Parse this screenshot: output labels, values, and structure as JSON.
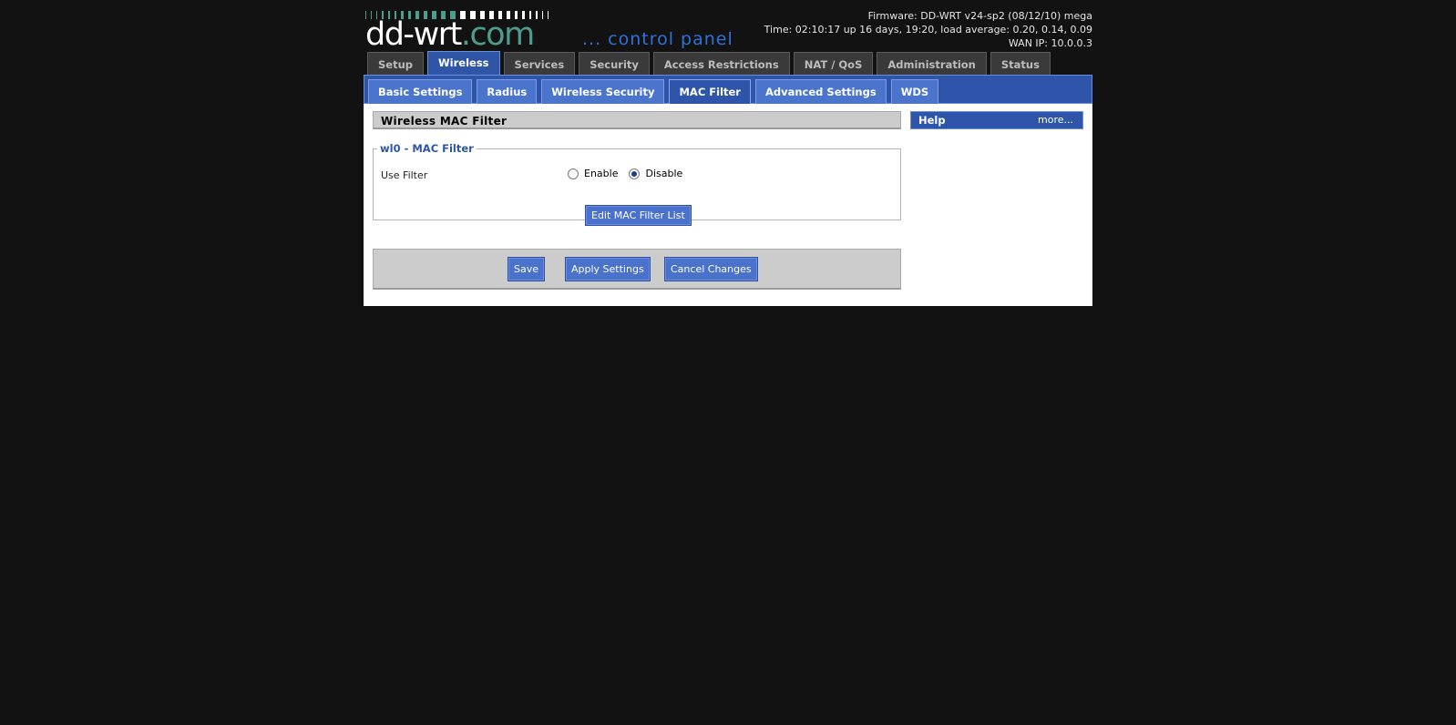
{
  "logo": {
    "main": "dd-wrt",
    "dotcom": ".com",
    "tagline": "... control panel",
    "bar_colors": [
      "#4d9c8e",
      "#ffffff"
    ]
  },
  "info": {
    "firmware": "Firmware: DD-WRT v24-sp2 (08/12/10) mega",
    "time": "Time: 02:10:17 up 16 days, 19:20, load average: 0.20, 0.14, 0.09",
    "wan_ip": "WAN IP: 10.0.0.3"
  },
  "main_tabs": [
    {
      "label": "Setup",
      "active": false
    },
    {
      "label": "Wireless",
      "active": true
    },
    {
      "label": "Services",
      "active": false
    },
    {
      "label": "Security",
      "active": false
    },
    {
      "label": "Access Restrictions",
      "active": false
    },
    {
      "label": "NAT / QoS",
      "active": false
    },
    {
      "label": "Administration",
      "active": false
    },
    {
      "label": "Status",
      "active": false
    }
  ],
  "sub_tabs": [
    {
      "label": "Basic Settings",
      "active": false
    },
    {
      "label": "Radius",
      "active": false
    },
    {
      "label": "Wireless Security",
      "active": false
    },
    {
      "label": "MAC Filter",
      "active": true
    },
    {
      "label": "Advanced Settings",
      "active": false
    },
    {
      "label": "WDS",
      "active": false
    }
  ],
  "content": {
    "section_title": "Wireless MAC Filter",
    "fieldset_legend": "wl0 - MAC Filter",
    "use_filter_label": "Use Filter",
    "options": {
      "enable": "Enable",
      "disable": "Disable",
      "selected": "Disable"
    },
    "edit_button": "Edit MAC Filter List"
  },
  "buttons": {
    "save": "Save",
    "apply": "Apply Settings",
    "cancel": "Cancel Changes"
  },
  "help": {
    "title": "Help",
    "more": "more..."
  },
  "colors": {
    "background": "#121212",
    "accent": "#2e55a9",
    "button": "#4a72cc",
    "logo_teal": "#4d9c8e",
    "tagline_blue": "#3070dc"
  }
}
